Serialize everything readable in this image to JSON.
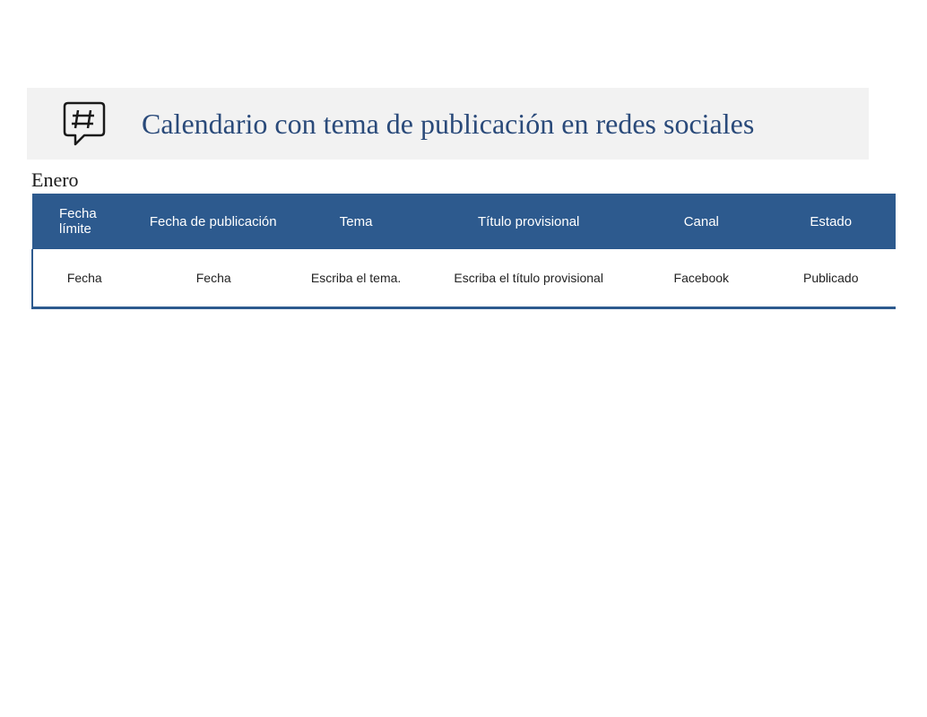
{
  "header": {
    "title": "Calendario con tema de publicación en redes sociales",
    "icon": "hashtag-speech-icon"
  },
  "month": "Enero",
  "table": {
    "columns": {
      "deadline": "Fecha límite",
      "pubdate": "Fecha de publicación",
      "topic": "Tema",
      "title": "Título provisional",
      "channel": "Canal",
      "status": "Estado"
    },
    "rows": [
      {
        "deadline": "Fecha",
        "pubdate": "Fecha",
        "topic": "Escriba el tema.",
        "title": "Escriba el título provisional",
        "channel": "Facebook",
        "status": "Publicado"
      }
    ]
  },
  "colors": {
    "header_bg": "#2d5a8e",
    "banner_bg": "#f2f2f2",
    "title_color": "#2a4a7a"
  }
}
